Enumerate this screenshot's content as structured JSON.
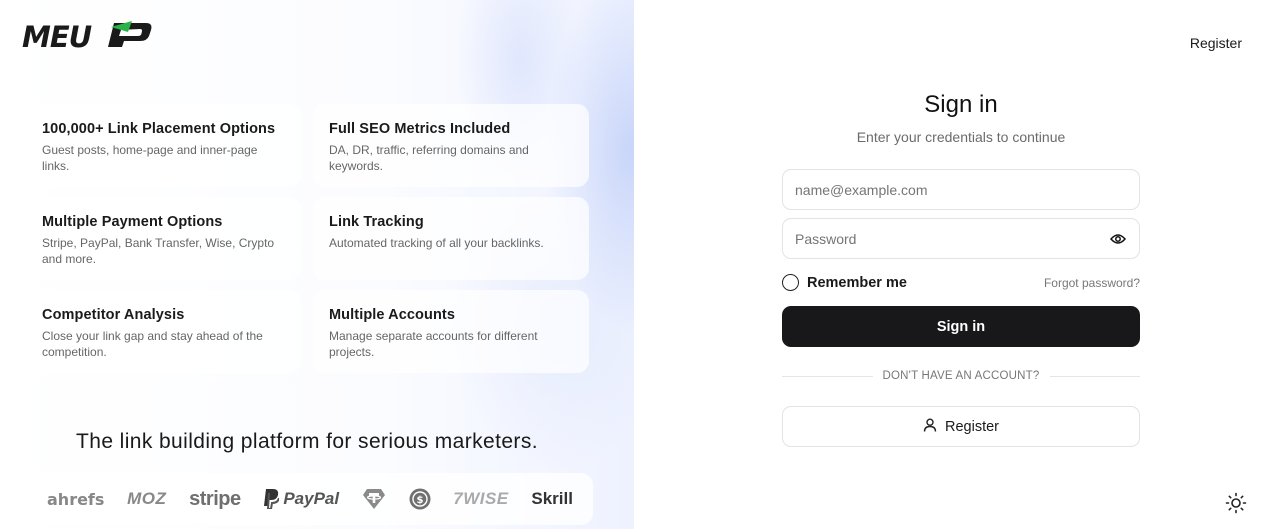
{
  "brand": {
    "logo_text": "MEUP",
    "accent_color": "#2bb34a",
    "text_color": "#1a1a1a"
  },
  "features": [
    {
      "title": "100,000+ Link Placement Options",
      "description": "Guest posts, home-page and inner-page links."
    },
    {
      "title": "Full SEO Metrics Included",
      "description": "DA, DR, traffic, referring domains and keywords."
    },
    {
      "title": "Multiple Payment Options",
      "description": "Stripe, PayPal, Bank Transfer, Wise, Crypto and more."
    },
    {
      "title": "Link Tracking",
      "description": "Automated tracking of all your backlinks."
    },
    {
      "title": "Competitor Analysis",
      "description": "Close your link gap and stay ahead of the competition."
    },
    {
      "title": "Multiple Accounts",
      "description": "Manage separate accounts for different projects."
    }
  ],
  "tagline": "The link building platform for serious marketers.",
  "partners": {
    "ahrefs": "ahrefs",
    "moz": "MOZ",
    "stripe": "stripe",
    "paypal": "PayPal",
    "tether": "tether-icon",
    "usdc": "usdc-icon",
    "wise": "7WISE",
    "skrill": "Skrill"
  },
  "header": {
    "register_link": "Register"
  },
  "signin": {
    "title": "Sign in",
    "subtitle": "Enter your credentials to continue",
    "email_placeholder": "name@example.com",
    "email_value": "",
    "password_placeholder": "Password",
    "password_value": "",
    "remember_label": "Remember me",
    "remember_checked": false,
    "forgot_label": "Forgot password?",
    "submit_label": "Sign in",
    "divider_text": "DON'T HAVE AN ACCOUNT?",
    "register_label": "Register",
    "button_color": "#18181b"
  },
  "icons": {
    "password_toggle": "eye-icon",
    "register": "user-icon",
    "theme": "sun-icon"
  }
}
